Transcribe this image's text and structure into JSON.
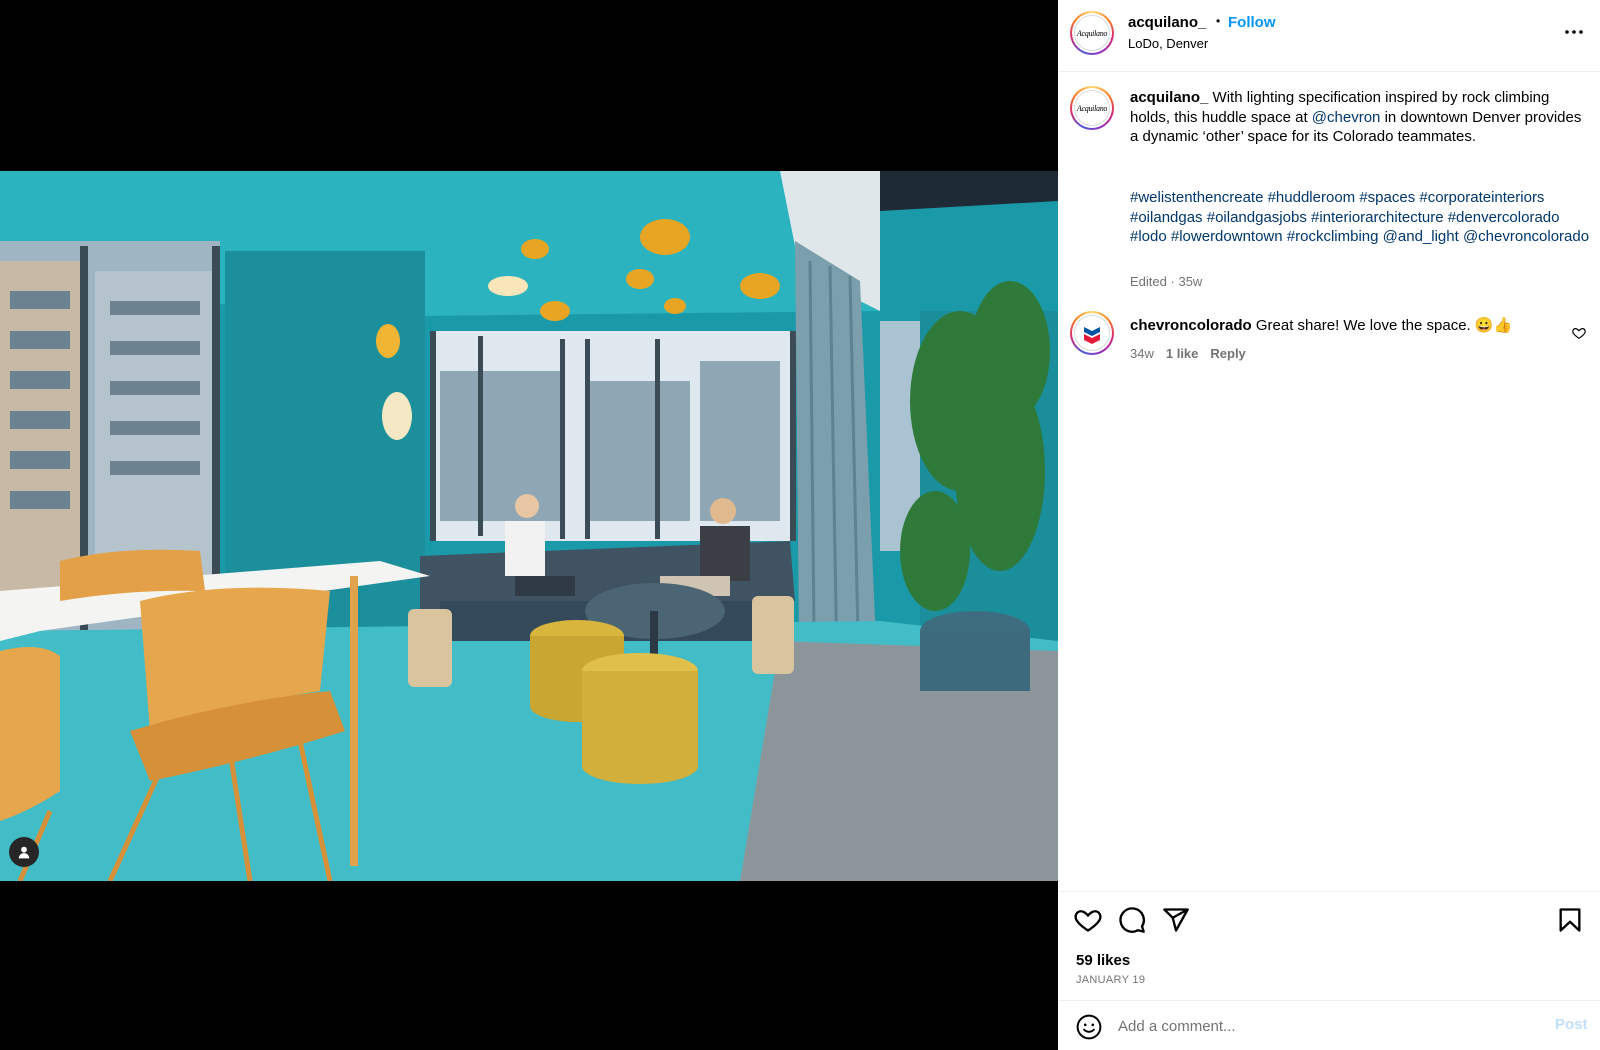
{
  "post": {
    "username": "acquilano_",
    "dot": "•",
    "follow_label": "Follow",
    "location": "LoDo, Denver",
    "avatar_text": "Acquilano",
    "more_icon": "more-horizontal-icon"
  },
  "caption": {
    "username": "acquilano_",
    "text_1": "With lighting specification inspired by rock climbing holds, this huddle space at",
    "mention": "@chevron",
    "text_2": "in downtown Denver provides a dynamic ‘other’ space for its Colorado teammates.",
    "hashtags": [
      "#welistenthencreate",
      "#huddleroom",
      "#spaces",
      "#corporateinteriors",
      "#oilandgas",
      "#oilandgasjobs",
      "#interiorarchitecture",
      "#denvercolorado",
      "#lodo",
      "#lowerdowntown",
      "#rockclimbing",
      "@and_light",
      "@chevroncolorado"
    ],
    "edited": "Edited",
    "separator": "·",
    "time": "35w"
  },
  "comment": {
    "username": "chevroncolorado",
    "text": "Great share! We love the space. 😀👍",
    "time": "34w",
    "likes": "1 like",
    "reply_label": "Reply",
    "avatar_text": "Chevron"
  },
  "actions": {
    "likes": "59 likes",
    "date": "JANUARY 19",
    "icons": [
      "heart-icon",
      "comment-icon",
      "share-icon",
      "bookmark-icon"
    ]
  },
  "comment_bar": {
    "placeholder": "Add a comment...",
    "post_label": "Post"
  },
  "colors": {
    "accent": "#0095f6",
    "link": "#00376b",
    "muted": "#737373",
    "post_disabled": "#c0dffd"
  }
}
